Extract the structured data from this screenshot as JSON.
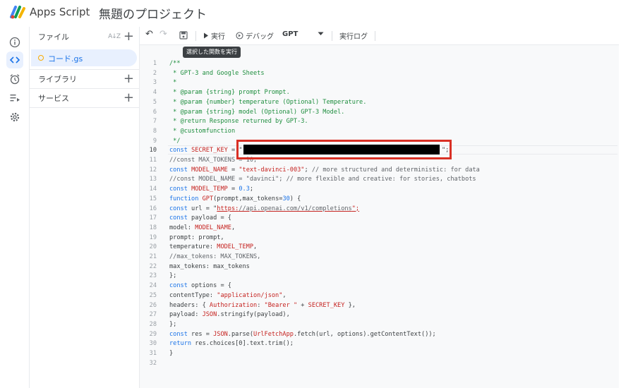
{
  "header": {
    "app_name": "Apps Script",
    "project_title": "無題のプロジェクト"
  },
  "rail": {
    "icons": [
      "info-icon",
      "code-icon",
      "alarm-clock-icon",
      "executions-icon",
      "settings-icon"
    ],
    "active": "code-icon"
  },
  "sidebar": {
    "files_label": "ファイル",
    "sort_label": "A↓Z",
    "file_name": "コード.gs",
    "libraries_label": "ライブラリ",
    "services_label": "サービス",
    "plus": "+"
  },
  "toolbar": {
    "undo": "↶",
    "redo": "↷",
    "save": "save-icon",
    "run_label": "実行",
    "debug_label": "デバッグ",
    "function_name": "GPT",
    "exec_log_label": "実行ログ",
    "tooltip": "選択した関数を実行"
  },
  "editor": {
    "lines": [
      {
        "n": "1",
        "t": "/**"
      },
      {
        "n": "2",
        "t": " * GPT-3 and Google Sheets"
      },
      {
        "n": "3",
        "t": " *"
      },
      {
        "n": "4",
        "t": " * @param {string} prompt Prompt."
      },
      {
        "n": "5",
        "t": " * @param {number} temperature (Optional) Temperature."
      },
      {
        "n": "6",
        "t": " * @param {string} model (Optional) GPT-3 Model."
      },
      {
        "n": "7",
        "t": " * @return Response returned by GPT-3."
      },
      {
        "n": "8",
        "t": " * @customfunction"
      },
      {
        "n": "9",
        "t": " */"
      },
      {
        "n": "10",
        "t": "const SECRET_KEY = \""
      },
      {
        "n": "11",
        "t": "//const MAX_TOKENS = 10;"
      },
      {
        "n": "12",
        "t": "const MODEL_NAME = \"text-davinci-003\"; // more structured and deterministic: for data"
      },
      {
        "n": "13",
        "t": "//const MODEL_NAME = \"davinci\"; // more flexible and creative: for stories, chatbots"
      },
      {
        "n": "14",
        "t": "const MODEL_TEMP = 0.3;"
      },
      {
        "n": "15",
        "t": "function GPT(prompt,max_tokens=30) {"
      },
      {
        "n": "16",
        "t": "const url = \"https://api.openai.com/v1/completions\";"
      },
      {
        "n": "17",
        "t": "const payload = {"
      },
      {
        "n": "18",
        "t": "model: MODEL_NAME,"
      },
      {
        "n": "19",
        "t": "prompt: prompt,"
      },
      {
        "n": "20",
        "t": "temperature: MODEL_TEMP,"
      },
      {
        "n": "21",
        "t": "//max_tokens: MAX_TOKENS,"
      },
      {
        "n": "22",
        "t": "max_tokens: max_tokens"
      },
      {
        "n": "23",
        "t": "};"
      },
      {
        "n": "24",
        "t": "const options = {"
      },
      {
        "n": "25",
        "t": "contentType: \"application/json\","
      },
      {
        "n": "26",
        "t": "headers: { Authorization: \"Bearer \" + SECRET_KEY },"
      },
      {
        "n": "27",
        "t": "payload: JSON.stringify(payload),"
      },
      {
        "n": "28",
        "t": "};"
      },
      {
        "n": "29",
        "t": "const res = JSON.parse(UrlFetchApp.fetch(url, options).getContentText());"
      },
      {
        "n": "30",
        "t": "return res.choices[0].text.trim();"
      },
      {
        "n": "31",
        "t": "}"
      },
      {
        "n": "32",
        "t": ""
      }
    ],
    "redacted_tail": "\";",
    "redaction_color": "#000000",
    "highlight_color": "#d93025"
  }
}
